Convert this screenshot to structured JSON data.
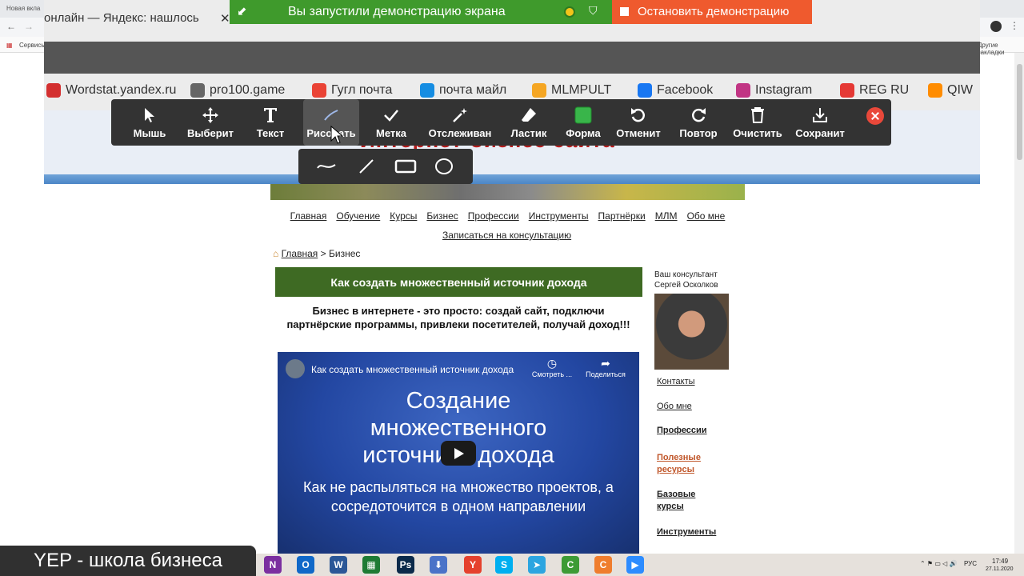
{
  "outer": {
    "tab_title": "Новая вкла",
    "bookmarks_left": "Сервисы",
    "bookmarks_right": "Другие закладки"
  },
  "inner_browser": {
    "tab_title": "онлайн — Яндекс: нашлось",
    "tab_close": "✕",
    "bookmarks": [
      {
        "label": "Wordstat.yandex.ru",
        "icon": "wordstat-icon",
        "color": "#d32f2f"
      },
      {
        "label": "pro100.game",
        "icon": "globe-icon",
        "color": "#666666"
      },
      {
        "label": "Гугл почта",
        "icon": "gmail-icon",
        "color": "#ea4335"
      },
      {
        "label": "почта майл",
        "icon": "mailru-icon",
        "color": "#168de2"
      },
      {
        "label": "MLMPULT",
        "icon": "mlmpult-icon",
        "color": "#f5a623"
      },
      {
        "label": "Facebook",
        "icon": "facebook-icon",
        "color": "#1877f2"
      },
      {
        "label": "Instagram",
        "icon": "instagram-icon",
        "color": "#c13584"
      },
      {
        "label": "REG RU",
        "icon": "regru-icon",
        "color": "#e53935"
      },
      {
        "label": "QIW",
        "icon": "qiwi-icon",
        "color": "#ff8c00"
      }
    ]
  },
  "share_bar": {
    "status": "Вы запустили демонстрацию экрана",
    "stop_label": "Остановить демонстрацию",
    "status_color": "#3f9a2c",
    "stop_color": "#ef5a2e"
  },
  "annotate": {
    "tools": [
      {
        "label": "Мышь",
        "icon": "mouse-pointer-icon"
      },
      {
        "label": "Выберит",
        "icon": "move-select-icon"
      },
      {
        "label": "Текст",
        "icon": "text-icon"
      },
      {
        "label": "Рисовать",
        "icon": "pen-icon",
        "active": true
      },
      {
        "label": "Метка",
        "icon": "check-icon"
      },
      {
        "label": "Отслеживан",
        "icon": "spotlight-wand-icon"
      },
      {
        "label": "Ластик",
        "icon": "eraser-icon"
      },
      {
        "label": "Форма",
        "icon": "color-square-icon"
      },
      {
        "label": "Отменит",
        "icon": "undo-icon"
      },
      {
        "label": "Повтор",
        "icon": "redo-icon"
      },
      {
        "label": "Очистить",
        "icon": "trash-icon"
      },
      {
        "label": "Сохранит",
        "icon": "save-icon"
      }
    ],
    "shape_options": [
      "freehand-icon",
      "line-icon",
      "rectangle-icon",
      "ellipse-icon"
    ]
  },
  "site": {
    "banner_title": "Интернет-бизнес сайта",
    "nav": [
      "Главная",
      "Обучение",
      "Курсы",
      "Бизнес",
      "Профессии",
      "Инструменты",
      "Партнёрки",
      "МЛМ",
      "Обо мне"
    ],
    "nav_active": "Бизнес",
    "consult": "Записаться на консультацию",
    "breadcrumb_home": "Главная",
    "breadcrumb_sep": ">",
    "breadcrumb_current": "Бизнес",
    "article_title": "Как создать множественный источник дохода",
    "lead": "Бизнес в интернете - это просто: создай сайт, подключи партнёрские программы, привлеки посетителей, получай доход!!!",
    "video": {
      "title": "Как создать множественный источник дохода",
      "watch_later": "Смотреть ...",
      "share": "Поделиться",
      "headline": "Создание множественного источника дохода",
      "subline": "Как не распыляться на множество проектов, а сосредоточится в одном направлении"
    },
    "sidebar": {
      "caption": "Ваш консультант Сергей Осколков",
      "links": [
        "Контакты",
        "Обо мне"
      ],
      "sections": [
        "Профессии",
        "Полезные ресурсы",
        "Базовые курсы",
        "Инструменты"
      ]
    }
  },
  "overlay_label": "YEP - школа бизнеса",
  "taskbar": {
    "apps": [
      {
        "name": "onenote-icon",
        "glyph": "N",
        "color": "#7b2fa0"
      },
      {
        "name": "outlook-icon",
        "glyph": "O",
        "color": "#1068c8"
      },
      {
        "name": "word-icon",
        "glyph": "W",
        "color": "#2b5797"
      },
      {
        "name": "spreadsheet-icon",
        "glyph": "▦",
        "color": "#1e7b34"
      },
      {
        "name": "photoshop-icon",
        "glyph": "Ps",
        "color": "#0b2a4a"
      },
      {
        "name": "installer-icon",
        "glyph": "⬇",
        "color": "#4a73c8"
      },
      {
        "name": "yandex-browser-icon",
        "glyph": "Y",
        "color": "#e5412d"
      },
      {
        "name": "skype-icon",
        "glyph": "S",
        "color": "#00aff0"
      },
      {
        "name": "telegram-icon",
        "glyph": "➤",
        "color": "#2ca5e0"
      },
      {
        "name": "camtasia-green-icon",
        "glyph": "C",
        "color": "#3d9b35"
      },
      {
        "name": "camtasia-orange-icon",
        "glyph": "C",
        "color": "#ef7d2d"
      },
      {
        "name": "zoom-icon",
        "glyph": "▶",
        "color": "#2d8cff"
      }
    ],
    "lang": "РУС",
    "time": "17:49",
    "date": "27.11.2020"
  }
}
